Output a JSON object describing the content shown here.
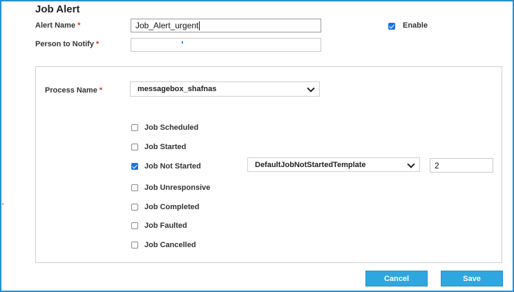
{
  "dialog": {
    "title": "Job Alert"
  },
  "form": {
    "alert_name_label": "Alert Name",
    "alert_name_value": "Job_Alert_urgent",
    "required_mark": "*",
    "enable_label": "Enable",
    "enable_checked": true,
    "person_label": "Person to Notify",
    "person_value": ""
  },
  "process": {
    "label": "Process Name",
    "selected": "messagebox_shafnas"
  },
  "events": [
    {
      "label": "Job Scheduled",
      "checked": false
    },
    {
      "label": "Job Started",
      "checked": false
    },
    {
      "label": "Job Not Started",
      "checked": true
    },
    {
      "label": "Job Unresponsive",
      "checked": false
    },
    {
      "label": "Job Completed",
      "checked": false
    },
    {
      "label": "Job Faulted",
      "checked": false
    },
    {
      "label": "Job Cancelled",
      "checked": false
    }
  ],
  "not_started": {
    "template": "DefaultJobNotStartedTemplate",
    "value": "2"
  },
  "buttons": {
    "cancel": "Cancel",
    "save": "Save"
  },
  "colors": {
    "accent": "#2ea7e0",
    "frame": "#1f8fd6",
    "checkbox_on": "#1a73e8",
    "required": "#d93025"
  }
}
